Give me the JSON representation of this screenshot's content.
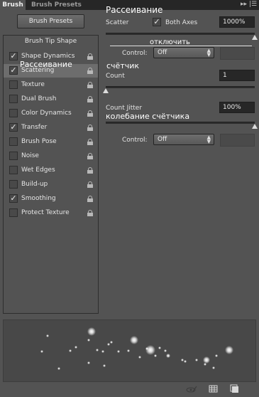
{
  "tabs": {
    "active": "Brush",
    "inactive": "Brush Presets"
  },
  "left": {
    "presets_button": "Brush Presets",
    "tip_shape_header": "Brush Tip Shape",
    "options": [
      {
        "label": "Shape Dynamics",
        "checked": true,
        "selected": false
      },
      {
        "label": "Scattering",
        "checked": true,
        "selected": true
      },
      {
        "label": "Texture",
        "checked": false,
        "selected": false
      },
      {
        "label": "Dual Brush",
        "checked": false,
        "selected": false
      },
      {
        "label": "Color Dynamics",
        "checked": false,
        "selected": false
      },
      {
        "label": "Transfer",
        "checked": true,
        "selected": false
      },
      {
        "label": "Brush Pose",
        "checked": false,
        "selected": false
      },
      {
        "label": "Noise",
        "checked": false,
        "selected": false
      },
      {
        "label": "Wet Edges",
        "checked": false,
        "selected": false
      },
      {
        "label": "Build-up",
        "checked": false,
        "selected": false
      },
      {
        "label": "Smoothing",
        "checked": true,
        "selected": false
      },
      {
        "label": "Protect Texture",
        "checked": false,
        "selected": false
      }
    ],
    "overlay_label": "Рассеивание"
  },
  "scatter": {
    "label": "Scatter",
    "both_axes_label": "Both Axes",
    "both_axes_checked": true,
    "value": "1000%",
    "slider_fraction": 1.0,
    "control_label": "Control:",
    "control_value": "Off",
    "overlay_title": "Рассеивание",
    "overlay_control": "отключить"
  },
  "count": {
    "label": "Count",
    "value": "1",
    "slider_fraction": 0.0,
    "overlay": "счётчик"
  },
  "count_jitter": {
    "label": "Count Jitter",
    "value": "100%",
    "slider_fraction": 1.0,
    "control_label": "Control:",
    "control_value": "Off",
    "overlay": "колебание счётчика"
  },
  "icons": [
    "collapse-icon",
    "panel-menu-icon",
    "lock-icon",
    "eye-brush-icon",
    "grid-icon",
    "new-preset-icon"
  ]
}
